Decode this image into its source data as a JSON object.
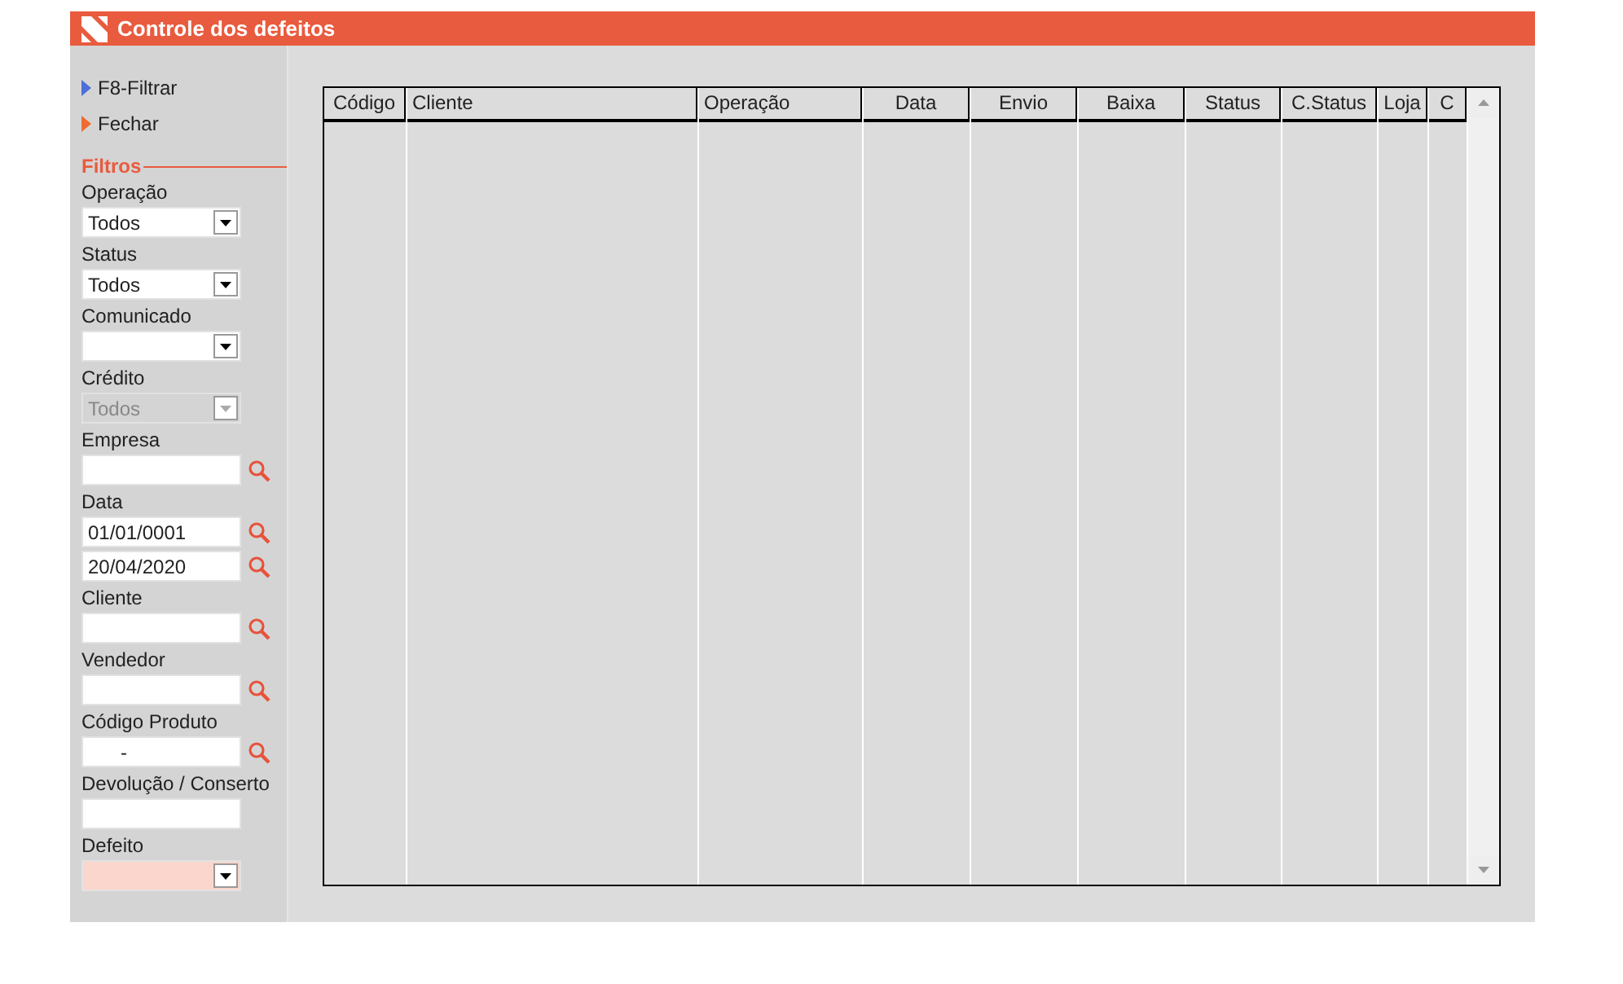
{
  "window": {
    "title": "Controle dos defeitos"
  },
  "actions": [
    {
      "label": "F8-Filtrar",
      "color": "#4f6fd8"
    },
    {
      "label": "Fechar",
      "color": "#f06a30"
    }
  ],
  "filters_title": "Filtros",
  "filters": [
    {
      "label": "Operação",
      "kind": "select",
      "values": [
        "Todos"
      ],
      "disabled": false,
      "search": false,
      "required": false
    },
    {
      "label": "Status",
      "kind": "select",
      "values": [
        "Todos"
      ],
      "disabled": false,
      "search": false,
      "required": false
    },
    {
      "label": "Comunicado",
      "kind": "select",
      "disabled": false,
      "search": false,
      "required": false
    },
    {
      "label": "Crédito",
      "kind": "select",
      "values": [
        "Todos"
      ],
      "disabled": true,
      "search": false,
      "required": false
    },
    {
      "label": "Empresa",
      "kind": "text",
      "disabled": false,
      "search": true,
      "required": false
    },
    {
      "label": "Data",
      "kind": "text",
      "values": [
        "01/01/0001",
        "20/04/2020"
      ],
      "disabled": false,
      "search": true,
      "required": false
    },
    {
      "label": "Cliente",
      "kind": "text",
      "disabled": false,
      "search": true,
      "required": false
    },
    {
      "label": "Vendedor",
      "kind": "text",
      "disabled": false,
      "search": true,
      "required": false
    },
    {
      "label": "Código Produto",
      "kind": "text",
      "values": [
        "      -"
      ],
      "disabled": false,
      "search": true,
      "required": false
    },
    {
      "label": "Devolução / Conserto",
      "kind": "text",
      "disabled": false,
      "search": false,
      "required": false
    },
    {
      "label": "Defeito",
      "kind": "select",
      "disabled": false,
      "search": false,
      "required": true
    }
  ],
  "table": {
    "columns": [
      {
        "label": "Código"
      },
      {
        "label": "Cliente"
      },
      {
        "label": "Operação"
      },
      {
        "label": "Data"
      },
      {
        "label": "Envio"
      },
      {
        "label": "Baixa"
      },
      {
        "label": "Status"
      },
      {
        "label": "C.Status"
      },
      {
        "label": "Loja"
      },
      {
        "label": "C"
      }
    ]
  }
}
